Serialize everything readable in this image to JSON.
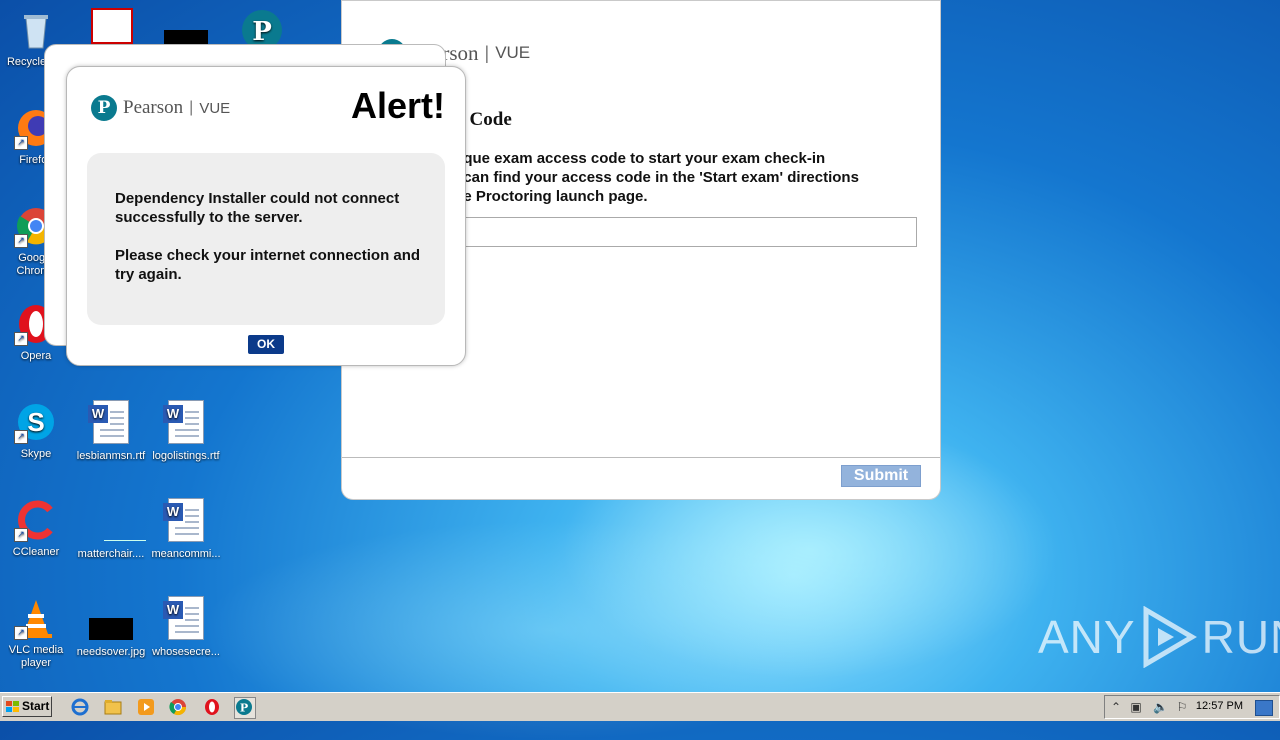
{
  "desktop": {
    "icons": [
      {
        "label": "Recycle Bin",
        "icon": "recycle-bin-icon"
      },
      {
        "label": "Firefox",
        "icon": "firefox-icon"
      },
      {
        "label": "Google Chrome",
        "icon": "chrome-icon"
      },
      {
        "label": "Opera",
        "icon": "opera-icon"
      },
      {
        "label": "Skype",
        "icon": "skype-icon"
      },
      {
        "label": "CCleaner",
        "icon": "ccleaner-icon"
      },
      {
        "label": "VLC media player",
        "icon": "vlc-icon"
      },
      {
        "label": "lesbianmsn.rtf",
        "icon": "word-document-icon"
      },
      {
        "label": "logolistings.rtf",
        "icon": "word-document-icon"
      },
      {
        "label": "matterchair....",
        "icon": "blank-file-icon"
      },
      {
        "label": "meancommi...",
        "icon": "word-document-icon"
      },
      {
        "label": "needsover.jpg",
        "icon": "image-file-icon"
      },
      {
        "label": "whosesecre...",
        "icon": "word-document-icon"
      }
    ]
  },
  "vue_window": {
    "logo_text": "Pearson",
    "logo_suffix": "VUE",
    "heading": "ss Code",
    "paragraph_lines": [
      "nique exam access code to start your exam check-in",
      "u can find your access code in the 'Start exam' directions",
      "ine Proctoring launch page."
    ],
    "access_code_value": "",
    "submit_label": "Submit"
  },
  "alert_dialog": {
    "logo_text": "Pearson",
    "logo_suffix": "VUE",
    "title": "Alert!",
    "message_1": "Dependency Installer could not connect successfully to the server.",
    "message_2": "Please check your internet connection and try again.",
    "ok_label": "OK"
  },
  "taskbar": {
    "start_label": "Start",
    "clock": "12:57 PM",
    "pinned": [
      "internet-explorer-icon",
      "file-explorer-icon",
      "media-player-icon",
      "chrome-icon",
      "opera-icon",
      "pearson-vue-icon"
    ]
  },
  "watermark": {
    "left": "ANY",
    "right": "RUN"
  },
  "colors": {
    "alert_ok": "#0b3a8a",
    "submit": "#93b3dc",
    "pearson_teal": "#0a7a8f"
  }
}
